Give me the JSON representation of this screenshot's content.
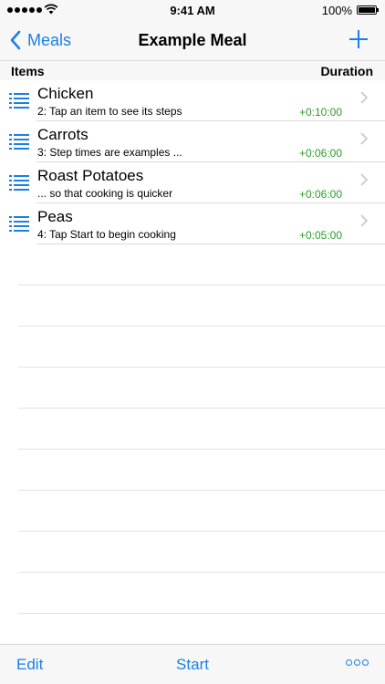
{
  "status_bar": {
    "time": "9:41 AM",
    "battery": "100%"
  },
  "nav": {
    "back_label": "Meals",
    "title": "Example Meal"
  },
  "section_header": {
    "left": "Items",
    "right": "Duration"
  },
  "items": [
    {
      "title": "Chicken",
      "subtitle": "2: Tap an item to see its steps",
      "duration": "+0:10:00"
    },
    {
      "title": "Carrots",
      "subtitle": "3: Step times are examples ...",
      "duration": "+0:06:00"
    },
    {
      "title": "Roast Potatoes",
      "subtitle": "... so that cooking is quicker",
      "duration": "+0:06:00"
    },
    {
      "title": "Peas",
      "subtitle": "4: Tap Start to begin cooking",
      "duration": "+0:05:00"
    }
  ],
  "toolbar": {
    "edit_label": "Edit",
    "start_label": "Start"
  },
  "icons": {
    "back": "chevron-left-icon",
    "add": "plus-icon",
    "item": "list-icon",
    "disclosure": "chevron-right-icon",
    "more": "more-icon"
  },
  "colors": {
    "accent": "#1a7fe6",
    "duration": "#2a9c2a",
    "bar_background": "#f7f7f7"
  }
}
